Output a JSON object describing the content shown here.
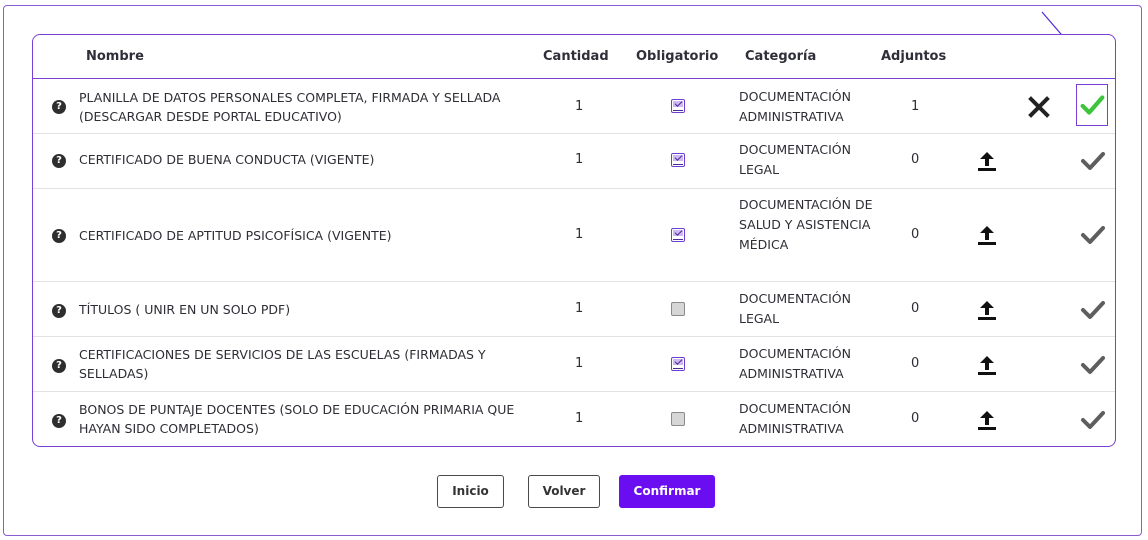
{
  "table": {
    "headers": {
      "name": "Nombre",
      "quantity": "Cantidad",
      "required": "Obligatorio",
      "category": "Categoría",
      "attachments": "Adjuntos"
    },
    "rows": [
      {
        "help": "?",
        "name": "PLANILLA DE DATOS PERSONALES COMPLETA, FIRMADA Y SELLADA (DESCARGAR DESDE PORTAL EDUCATIVO)",
        "quantity": "1",
        "required": true,
        "category": "DOCUMENTACIÓN ADMINISTRATIVA",
        "attachments": "1",
        "actions": [
          "x-icon",
          "check-icon-green"
        ]
      },
      {
        "help": "?",
        "name": "CERTIFICADO DE BUENA CONDUCTA (VIGENTE)",
        "quantity": "1",
        "required": true,
        "category": "DOCUMENTACIÓN LEGAL",
        "attachments": "0",
        "actions": [
          "upload-icon",
          "check-icon"
        ]
      },
      {
        "help": "?",
        "name": "CERTIFICADO DE APTITUD PSICOFÍSICA (VIGENTE)",
        "quantity": "1",
        "required": true,
        "category": "DOCUMENTACIÓN DE SALUD Y ASISTENCIA MÉDICA",
        "attachments": "0",
        "actions": [
          "upload-icon",
          "check-icon"
        ]
      },
      {
        "help": "?",
        "name": "TÍTULOS ( UNIR EN UN SOLO PDF)",
        "quantity": "1",
        "required": false,
        "category": "DOCUMENTACIÓN LEGAL",
        "attachments": "0",
        "actions": [
          "upload-icon",
          "check-icon"
        ]
      },
      {
        "help": "?",
        "name": "CERTIFICACIONES DE SERVICIOS DE LAS ESCUELAS (FIRMADAS Y SELLADAS)",
        "quantity": "1",
        "required": true,
        "category": "DOCUMENTACIÓN ADMINISTRATIVA",
        "attachments": "0",
        "actions": [
          "upload-icon",
          "check-icon"
        ]
      },
      {
        "help": "?",
        "name": "BONOS DE PUNTAJE DOCENTES (SOLO DE EDUCACIÓN PRIMARIA QUE HAYAN SIDO COMPLETADOS)",
        "quantity": "1",
        "required": false,
        "category": "DOCUMENTACIÓN ADMINISTRATIVA",
        "attachments": "0",
        "actions": [
          "upload-icon",
          "check-icon"
        ]
      }
    ]
  },
  "buttons": {
    "inicio": "Inicio",
    "volver": "Volver",
    "confirmar": "Confirmar"
  },
  "colors": {
    "accent": "#6a0df0",
    "border": "#7a3fd6",
    "check_green": "#3cc43a",
    "check_gray": "#5e5e5e"
  }
}
